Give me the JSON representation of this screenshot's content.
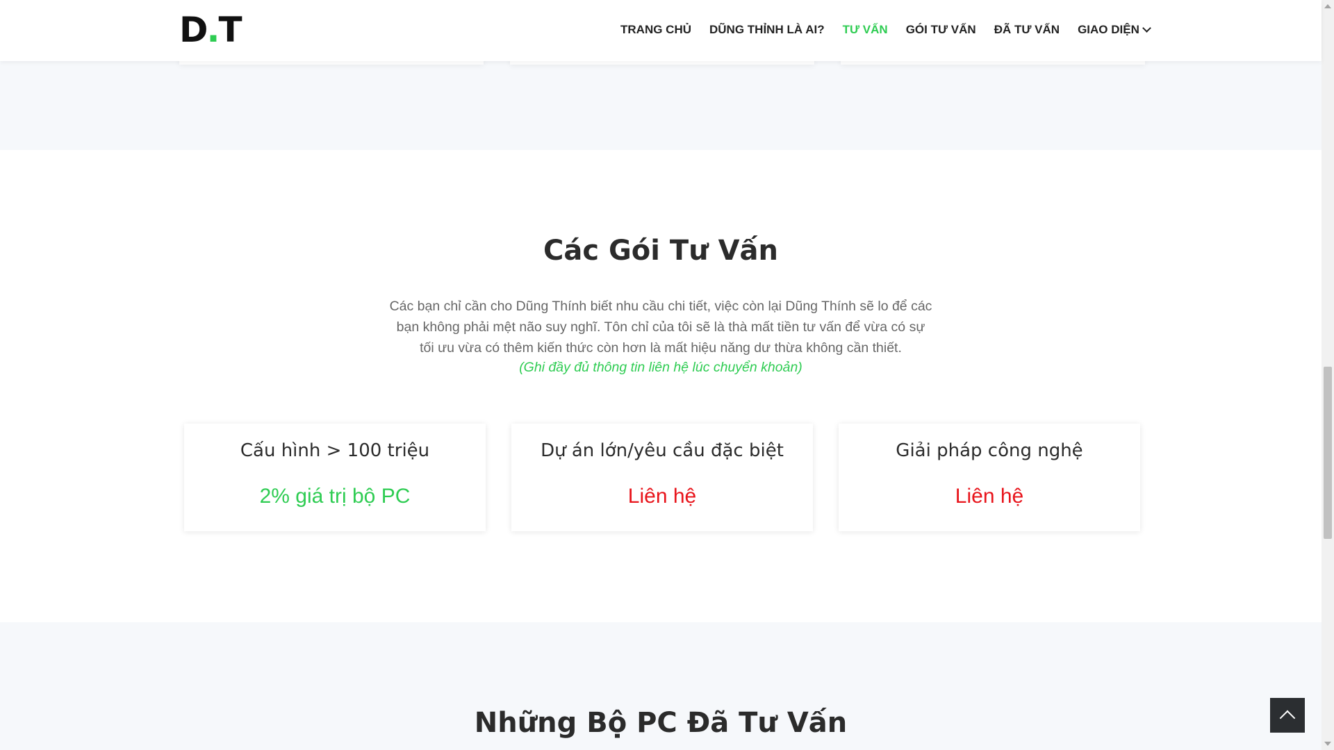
{
  "logo": {
    "text_main": "D",
    "text_dot": ".",
    "text_end": "T"
  },
  "nav": {
    "items": [
      {
        "label": "TRANG CHỦ"
      },
      {
        "label": "DŨNG THỈNH LÀ AI?"
      },
      {
        "label": "TƯ VẤN"
      },
      {
        "label": "GÓI TƯ VẤN"
      },
      {
        "label": "ĐÃ TƯ VẤN"
      },
      {
        "label": "GIAO DIỆN"
      }
    ],
    "active": "TƯ VẤN"
  },
  "packages": {
    "title": "Các Gói Tư Vấn",
    "description_lines": [
      "Các bạn chỉ cần cho Dũng Thính biết nhu cầu chi tiết, việc còn lại Dũng Thính sẽ lo để các",
      "bạn không phải mệt não suy nghĩ. Tôn chỉ của tôi sẽ là thà mất tiền tư vấn để vừa có sự",
      "tối ưu vừa có thêm kiến thức còn hơn là mất hiệu năng dư thừa không cần thiết."
    ],
    "note": "(Ghi đầy đủ thông tin liên hệ lúc chuyển khoản)",
    "cards": [
      {
        "title": "Cấu hình > 100 triệu",
        "price": "2% giá trị bộ PC",
        "price_color": "#2ecc52"
      },
      {
        "title": "Dự án lớn/yêu cầu đặc biệt",
        "price": "Liên hệ",
        "price_color": "#e8141b"
      },
      {
        "title": "Giải pháp công nghệ",
        "price": "Liên hệ",
        "price_color": "#e8141b"
      }
    ]
  },
  "next_section": {
    "title": "Những Bộ PC Đã Tư Vấn"
  },
  "colors": {
    "accent": "#2ecc52",
    "contact": "#e8141b",
    "heading": "#2b2b2b"
  },
  "icons": {
    "nav_dropdown": "chevron-down-icon",
    "back_to_top": "chevron-up-icon"
  }
}
